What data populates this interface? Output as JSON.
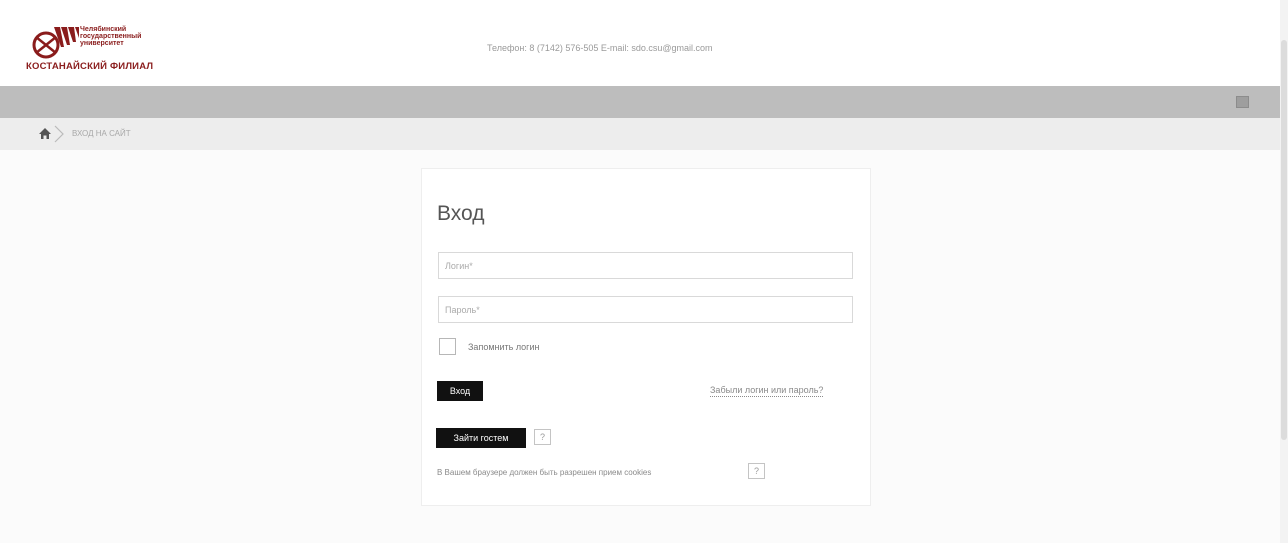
{
  "header": {
    "logo_lines": [
      "Челябинский",
      "государственный",
      "университет"
    ],
    "logo_branch": "КОСТАНАЙСКИЙ ФИЛИАЛ",
    "contact": "Телефон: 8 (7142) 576-505 E-mail: sdo.csu@gmail.com"
  },
  "breadcrumb": {
    "current": "ВХОД НА САЙТ"
  },
  "login": {
    "title": "Вход",
    "login_placeholder": "Логин*",
    "password_placeholder": "Пароль*",
    "remember_label": "Запомнить логин",
    "submit_label": "Вход",
    "forgot_link": "Забыли логин или пароль?",
    "guest_label": "Зайти гостем",
    "help_glyph": "?",
    "cookies_notice": "В Вашем браузере должен быть разрешен прием cookies"
  },
  "colors": {
    "brand": "#8a1c1c",
    "header_bar": "#bdbdbd",
    "breadcrumb_bar": "#ededed",
    "button": "#111111"
  }
}
